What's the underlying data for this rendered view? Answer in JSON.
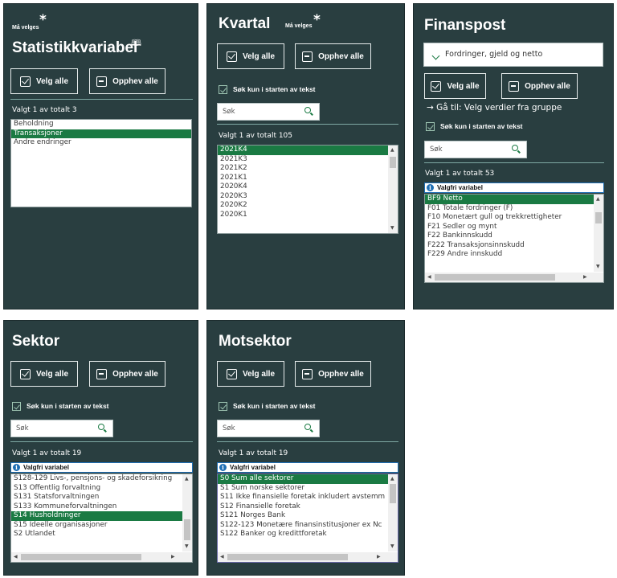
{
  "panels": {
    "statistikkvariabel": {
      "mandatory": "Må velges",
      "star": "*",
      "title": "Statistikkvariabel",
      "select_all": "Velg alle",
      "deselect_all": "Opphev alle",
      "count": "Valgt 1 av totalt 3",
      "items": [
        "Beholdning",
        "Transaksjoner",
        "Andre endringer"
      ],
      "selected_index": 1
    },
    "kvartal": {
      "title": "Kvartal",
      "mandatory": "Må velges",
      "star": "*",
      "select_all": "Velg alle",
      "deselect_all": "Opphev alle",
      "search_start_label": "Søk kun i starten av tekst",
      "search_placeholder": "Søk",
      "count": "Valgt 1 av totalt 105",
      "items": [
        "2021K4",
        "2021K3",
        "2021K2",
        "2021K1",
        "2020K4",
        "2020K3",
        "2020K2",
        "2020K1"
      ],
      "selected_index": 0
    },
    "finanspost": {
      "title": "Finanspost",
      "dropdown_value": "Fordringer, gjeld og netto",
      "select_all": "Velg alle",
      "deselect_all": "Opphev alle",
      "goto_label": "→ Gå til: Velg verdier fra gruppe",
      "search_start_label": "Søk kun i starten av tekst",
      "search_placeholder": "Søk",
      "count": "Valgt 1 av totalt 53",
      "info_label": "Valgfri variabel",
      "items": [
        "BF9 Netto",
        "F01 Totale fordringer (F)",
        "F10 Monetært gull og trekkrettigheter",
        "F21 Sedler og mynt",
        "F22 Bankinnskudd",
        "F222 Transaksjonsinnskudd",
        "F229 Andre innskudd"
      ],
      "selected_index": 0
    },
    "sektor": {
      "title": "Sektor",
      "select_all": "Velg alle",
      "deselect_all": "Opphev alle",
      "search_start_label": "Søk kun i starten av tekst",
      "search_placeholder": "Søk",
      "count": "Valgt 1 av totalt 19",
      "info_label": "Valgfri variabel",
      "items": [
        "S128-129 Livs-, pensjons- og skadeforsikring",
        "S13 Offentlig forvaltning",
        "S131 Statsforvaltningen",
        "S133 Kommuneforvaltningen",
        "S14 Husholdninger",
        "S15 Ideelle organisasjoner",
        "S2 Utlandet"
      ],
      "selected_index": 4
    },
    "motsektor": {
      "title": "Motsektor",
      "select_all": "Velg alle",
      "deselect_all": "Opphev alle",
      "search_start_label": "Søk kun i starten av tekst",
      "search_placeholder": "Søk",
      "count": "Valgt 1 av totalt 19",
      "info_label": "Valgfri variabel",
      "items": [
        "S0 Sum alle sektorer",
        "S1 Sum norske sektorer",
        "S11 Ikke finansielle foretak inkludert avstemm",
        "S12 Finansielle foretak",
        "S121 Norges Bank",
        "S122-123 Monetære finansinstitusjoner ex Nc",
        "S122 Banker og kredittforetak"
      ],
      "selected_index": 0
    }
  },
  "colors": {
    "panel_bg": "#293e40",
    "selected_item": "#1a7a43",
    "info_blue": "#1f6fb5"
  },
  "icons": {
    "select_all": "checkbox-checked-icon",
    "deselect_all": "checkbox-minus-icon",
    "search": "magnifier-icon",
    "info": "info-circle-icon",
    "definition": "book-icon",
    "dropdown": "chevron-down-icon"
  }
}
